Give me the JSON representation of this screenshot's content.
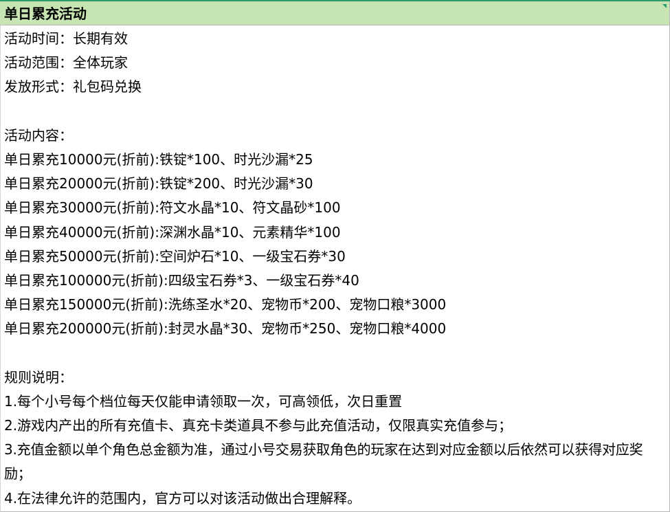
{
  "header": {
    "title": "单日累充活动"
  },
  "info": {
    "time": "活动时间：长期有效",
    "scope": "活动范围：全体玩家",
    "form": "发放形式：礼包码兑换"
  },
  "content": {
    "heading": "活动内容：",
    "tiers": [
      "单日累充10000元(折前):铁锭*100、时光沙漏*25",
      "单日累充20000元(折前):铁锭*200、时光沙漏*30",
      "单日累充30000元(折前):符文水晶*10、符文晶砂*100",
      "单日累充40000元(折前):深渊水晶*10、元素精华*100",
      "单日累充50000元(折前):空间炉石*10、一级宝石券*30",
      "单日累充100000元(折前):四级宝石券*3、一级宝石券*40",
      "单日累充150000元(折前):洗练圣水*20、宠物币*200、宠物口粮*3000",
      "单日累充200000元(折前):封灵水晶*30、宠物币*250、宠物口粮*4000"
    ]
  },
  "rules": {
    "heading": "规则说明：",
    "items": [
      "1.每个小号每个档位每天仅能申请领取一次，可高领低，次日重置",
      "2.游戏内产出的所有充值卡、真充卡类道具不参与此充值活动，仅限真实充值参与；",
      "3.充值金额以单个角色总金额为准，通过小号交易获取角色的玩家在达到对应金额以后依然可以获得对应奖励；",
      "4.在法律允许的范围内，官方可以对该活动做出合理解释。"
    ]
  },
  "colors": {
    "header_fill": "#c6e5b3",
    "top_rule": "#2e9b6e",
    "grid_line": "#b7b7b7"
  }
}
